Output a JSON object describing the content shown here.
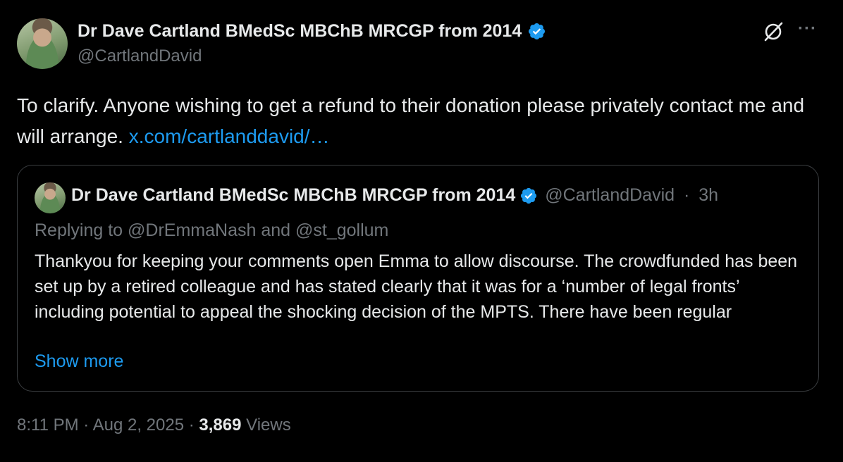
{
  "author": {
    "display_name": "Dr Dave Cartland BMedSc MBChB MRCGP from 2014",
    "handle": "@CartlandDavid",
    "verified": true
  },
  "tweet": {
    "text": "To clarify. Anyone wishing to get a refund to their donation please privately contact me and will arrange. ",
    "link_text": "x.com/cartlanddavid/…",
    "time": "8:11 PM",
    "separator": " · ",
    "date": "Aug 2, 2025",
    "views_count": "3,869",
    "views_label": "Views"
  },
  "quoted_tweet": {
    "display_name": "Dr Dave Cartland BMedSc MBChB MRCGP from 2014",
    "handle": "@CartlandDavid",
    "dot": " · ",
    "age": "3h",
    "replying_prefix": "Replying to ",
    "reply_handle_1": "@DrEmmaNash",
    "reply_and": " and ",
    "reply_handle_2": "@st_gollum",
    "text": "Thankyou for keeping your comments open Emma to allow discourse. The crowdfunded has been set up by a retired colleague and has stated clearly that it was for a ‘number of legal fronts’ including potential to appeal the shocking decision of the MPTS. There have been regular",
    "show_more": "Show more"
  },
  "icons": {
    "grok": "grok-icon",
    "more": "more-icon",
    "verified": "verified-badge-icon"
  },
  "colors": {
    "background": "#000000",
    "text": "#e7e9ea",
    "muted": "#71767b",
    "link": "#1d9bf0",
    "border": "#3a3d40"
  }
}
